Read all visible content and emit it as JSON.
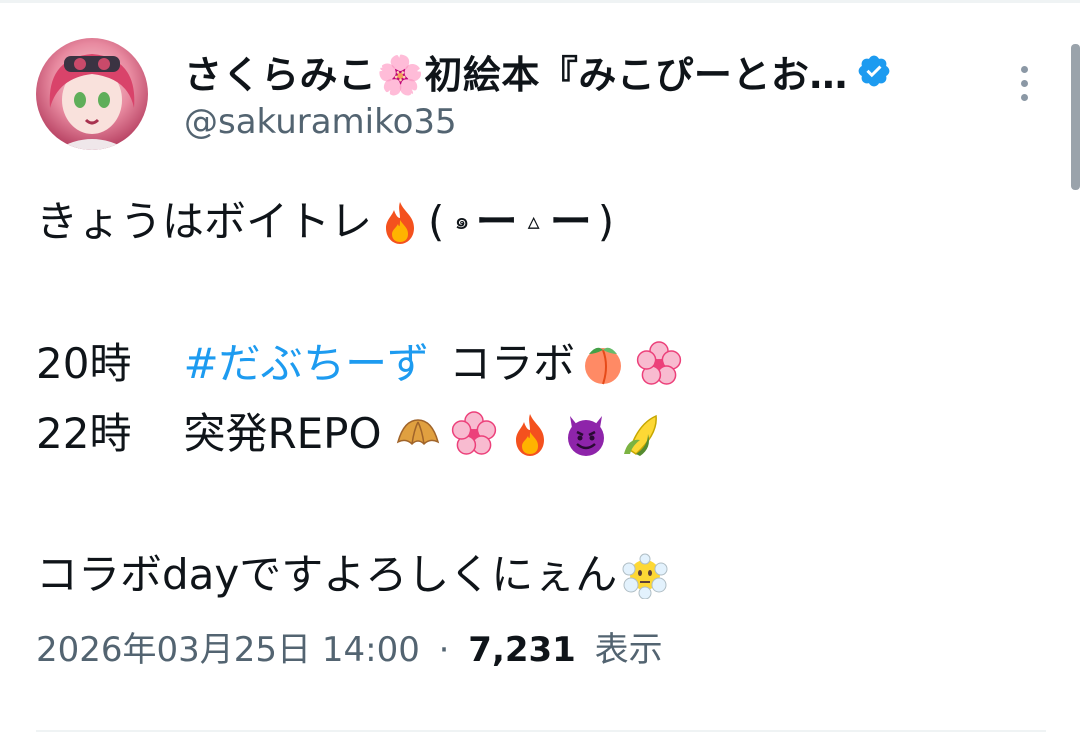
{
  "tweet": {
    "author": {
      "display_name": "さくらみこ🌸初絵本『みこぴーとお…",
      "handle": "@sakuramiko35",
      "verified_icon": "verified-badge-icon",
      "avatar_icon": "avatar"
    },
    "more_icon": "more-vertical-icon",
    "lines": {
      "line1_text": "きょうはボイトレ",
      "line1_kaomoji_open": "(",
      "line1_kaomoji_eye1": "๑",
      "line1_kaomoji_dash1": "ー",
      "line1_kaomoji_mouth": "▵",
      "line1_kaomoji_dash2": "ー",
      "line1_kaomoji_close": ")",
      "line2_time": "20時",
      "line2_hashtag": "#だぶちーず",
      "line2_text": "コラボ",
      "line3_time": "22時",
      "line3_text": "突発REPO",
      "line4_text": "コラボdayですよろしくにぇん"
    },
    "emojis": {
      "fire": "fire-icon",
      "peach": "peach-icon",
      "cherry_blossom": "cherry-blossom-icon",
      "croissant": "croissant-icon",
      "devil": "smiling-devil-icon",
      "corn": "corn-icon",
      "cloud_face": "face-in-clouds-icon"
    },
    "meta": {
      "timestamp": "2026年03月25日 14:00",
      "separator": "·",
      "views_count": "7,231",
      "views_label": "表示"
    },
    "colors": {
      "link": "#1d9bf0",
      "secondary_text": "#536471",
      "verified": "#1d9bf0"
    }
  }
}
